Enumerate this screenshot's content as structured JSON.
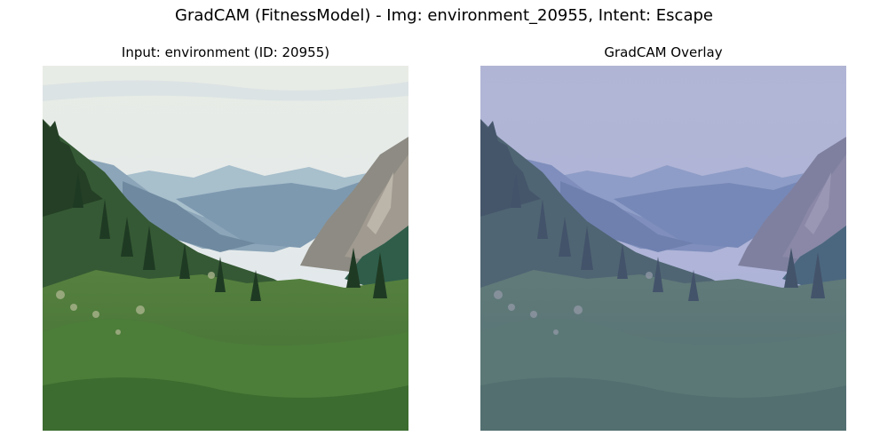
{
  "figure": {
    "title": "GradCAM (FitnessModel) - Img: environment_20955, Intent: Escape"
  },
  "panels": [
    {
      "title": "Input: environment (ID: 20955)",
      "content": "mountain valley landscape photograph"
    },
    {
      "title": "GradCAM Overlay",
      "content": "same landscape with uniform purple-blue heatmap overlay"
    }
  ],
  "colors": {
    "sky_top": "#e6ece8",
    "sky_bottom": "#dfe6ea",
    "far_mountains": "#9fb6c6",
    "mid_ridge": "#7f9bb4",
    "rock_right": "#8a8a82",
    "forest_dark": "#2f4a2e",
    "forest_mid": "#4f7a3c",
    "meadow": "#6c9a4b",
    "overlay_tint": "#6e74c0"
  }
}
